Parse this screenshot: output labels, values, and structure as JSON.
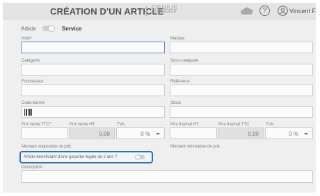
{
  "header": {
    "title": "CRÉATION D'UN ARTICLE",
    "brand_top": "Genius",
    "brand_bottom": "commerce",
    "user": "Vincent F",
    "help_glyph": "?"
  },
  "type_toggle": {
    "left_label": "Article",
    "right_label": "Service"
  },
  "labels": {
    "nom": "Nom*",
    "marque": "Marque",
    "categorie": "Catégorie",
    "sous_categorie": "Sous-catégorie",
    "fournisseur": "Fournisseur",
    "reference": "Référence",
    "code_barres": "Code-barres",
    "stock": "Stock",
    "prix_vente_ttc": "Prix vente TTC*",
    "prix_vente_ht": "Prix vente HT",
    "tva_vente": "TVA",
    "prix_achat_ht": "Prix d'achat HT",
    "prix_achat_ttc": "Prix d'achat TTC",
    "tva_achat": "TVA",
    "majoration": "Montant majoration de prix",
    "minoration": "Montant minoration de prix",
    "garantie": "Article bénéficiant d'une garantie légale de 2 ans ?",
    "description": "Description"
  },
  "values": {
    "prix_vente_ht": "0,00",
    "tva_vente": "0 %",
    "prix_achat_ttc": "0,00",
    "tva_achat": "0 %"
  }
}
